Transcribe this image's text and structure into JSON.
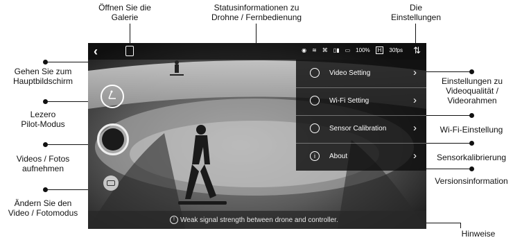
{
  "annotations": {
    "gallery": "Öffnen Sie die\nGalerie",
    "status": "Statusinformationen zu\nDrohne / Fernbedienung",
    "settings": "Die\nEinstellungen",
    "home": "Gehen Sie zum\nHauptbildschirm",
    "pilot": "Lezero\nPilot-Modus",
    "capture": "Videos / Fotos\naufnehmen",
    "mode": "Ändern Sie den\nVideo / Fotomodus",
    "video_setting": "Einstellungen zu\nVideoqualität /\nVideorahmen",
    "wifi_setting": "Wi-Fi-Einstellung",
    "sensor": "Sensorkalibrierung",
    "version": "Versionsinformation",
    "hints": "Hinweise"
  },
  "statusbar": {
    "battery": "100%",
    "quality": "H",
    "fps": "30fps"
  },
  "menu": {
    "items": [
      {
        "label": "Video Setting"
      },
      {
        "label": "Wi-Fi Setting"
      },
      {
        "label": "Sensor Calibration"
      },
      {
        "label": "About"
      }
    ]
  },
  "hint": {
    "text": "Weak signal strength between drone and controller."
  }
}
